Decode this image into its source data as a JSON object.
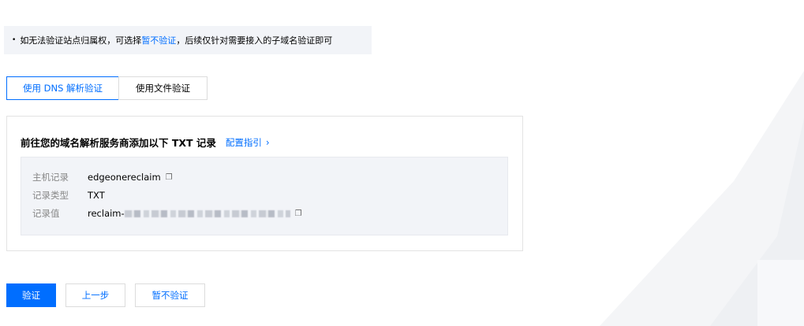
{
  "notice": {
    "bullet": "•",
    "text_before": "如无法验证站点归属权，可选择",
    "link": "暂不验证",
    "text_after": "，后续仅针对需要接入的子域名验证即可"
  },
  "tabs": [
    {
      "label": "使用 DNS 解析验证",
      "active": true
    },
    {
      "label": "使用文件验证",
      "active": false
    }
  ],
  "panel": {
    "title": "前往您的域名解析服务商添加以下 TXT 记录",
    "guide_link": "配置指引",
    "records": [
      {
        "label": "主机记录",
        "value": "edgeonereclaim"
      },
      {
        "label": "记录类型",
        "value": "TXT"
      },
      {
        "label": "记录值",
        "value": "reclaim-"
      }
    ]
  },
  "actions": {
    "verify": "验证",
    "prev": "上一步",
    "skip": "暂不验证"
  },
  "colors": {
    "accent": "#006eff",
    "notice_bg": "#f2f4f8",
    "label_gray": "#888888"
  },
  "icons": {
    "copy": "copy-icon",
    "chevron": "chevron-right-icon"
  }
}
